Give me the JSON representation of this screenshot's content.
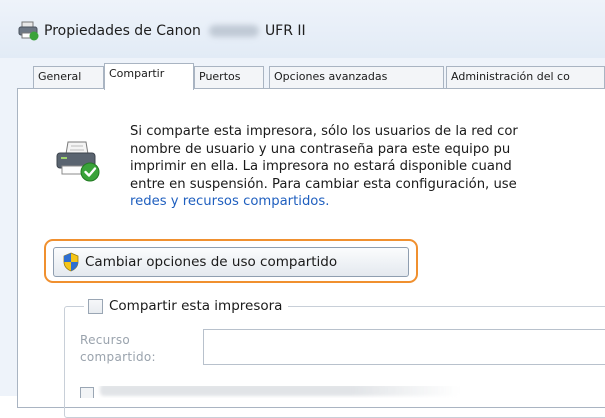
{
  "window": {
    "title_prefix": "Propiedades de Canon",
    "title_suffix": "UFR II"
  },
  "tabs": [
    {
      "label": "General",
      "active": false
    },
    {
      "label": "Compartir",
      "active": true
    },
    {
      "label": "Puertos",
      "active": false
    },
    {
      "label": "Opciones avanzadas",
      "active": false
    },
    {
      "label": "Administración del co",
      "active": false
    }
  ],
  "sharing": {
    "info_lines": [
      "Si comparte esta impresora, sólo los usuarios de la red cor",
      "nombre de usuario y una contraseña para este equipo pu",
      "imprimir en ella. La impresora no estará disponible cuand",
      "entre en suspensión. Para cambiar esta configuración, use"
    ],
    "link_text": "redes y recursos compartidos.",
    "change_button_label": "Cambiar opciones de uso compartido",
    "share_checkbox_label": "Compartir esta impresora",
    "share_checkbox_checked": false,
    "share_name_label_line1": "Recurso",
    "share_name_label_line2": "compartido:",
    "share_name_value": ""
  },
  "colors": {
    "highlight": "#f0902f",
    "link": "#1f5fbf"
  }
}
